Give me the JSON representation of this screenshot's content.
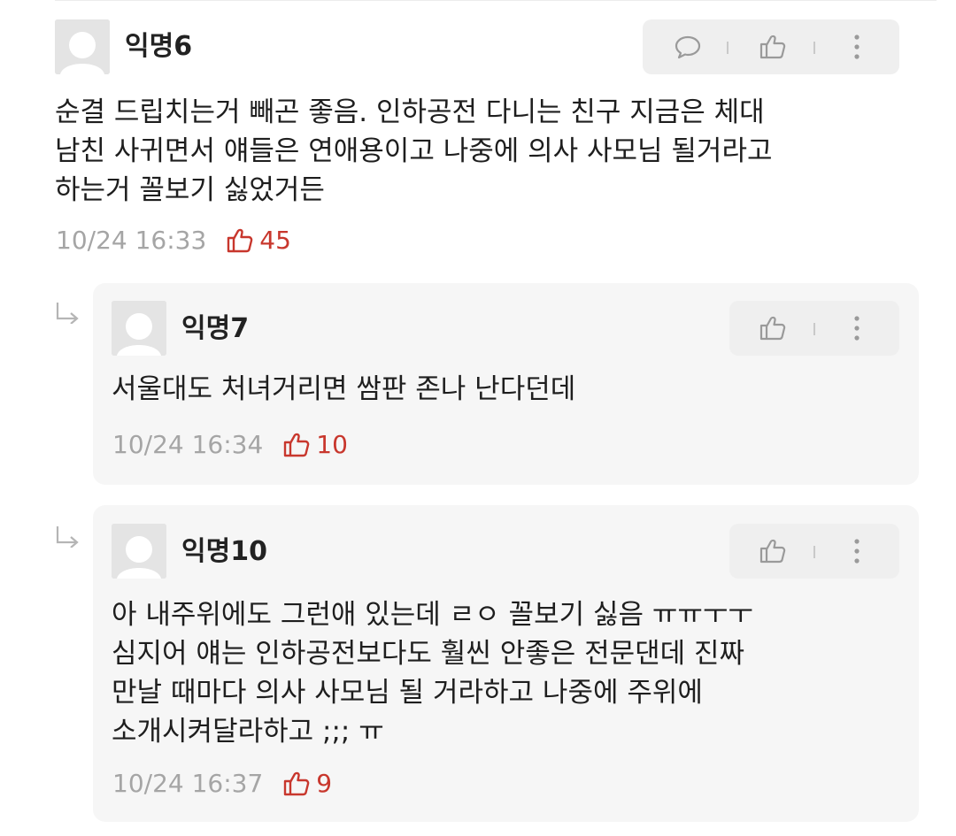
{
  "comments": [
    {
      "author": "익명6",
      "text": "순결 드립치는거 빼곤 좋음. 인하공전 다니는 친구 지금은 체대\n남친 사귀면서 얘들은 연애용이고 나중에 의사 사모님 될거라고\n하는거 꼴보기 싫었거든",
      "time": "10/24 16:33",
      "votes": "45",
      "actions": [
        "reply-icon",
        "thumbs-up-icon",
        "more-icon"
      ]
    },
    {
      "author": "익명7",
      "text": "서울대도 처녀거리면 쌈판 존나 난다던데",
      "time": "10/24 16:34",
      "votes": "10",
      "actions": [
        "thumbs-up-icon",
        "more-icon"
      ]
    },
    {
      "author": "익명10",
      "text": "아 내주위에도 그런애 있는데 ㄹㅇ 꼴보기 싫음 ㅠㅠㅜㅜ\n심지어 얘는 인하공전보다도 훨씬 안좋은 전문댄데 진짜\n만날 때마다 의사 사모님 될 거라하고 나중에 주위에\n소개시켜달라하고 ;;; ㅠ",
      "time": "10/24 16:37",
      "votes": "9",
      "actions": [
        "thumbs-up-icon",
        "more-icon"
      ]
    }
  ],
  "colors": {
    "vote_accent": "#c8372d",
    "meta_gray": "#a5a5a5",
    "reply_bg": "#f6f6f6",
    "action_bg": "#efefef"
  }
}
